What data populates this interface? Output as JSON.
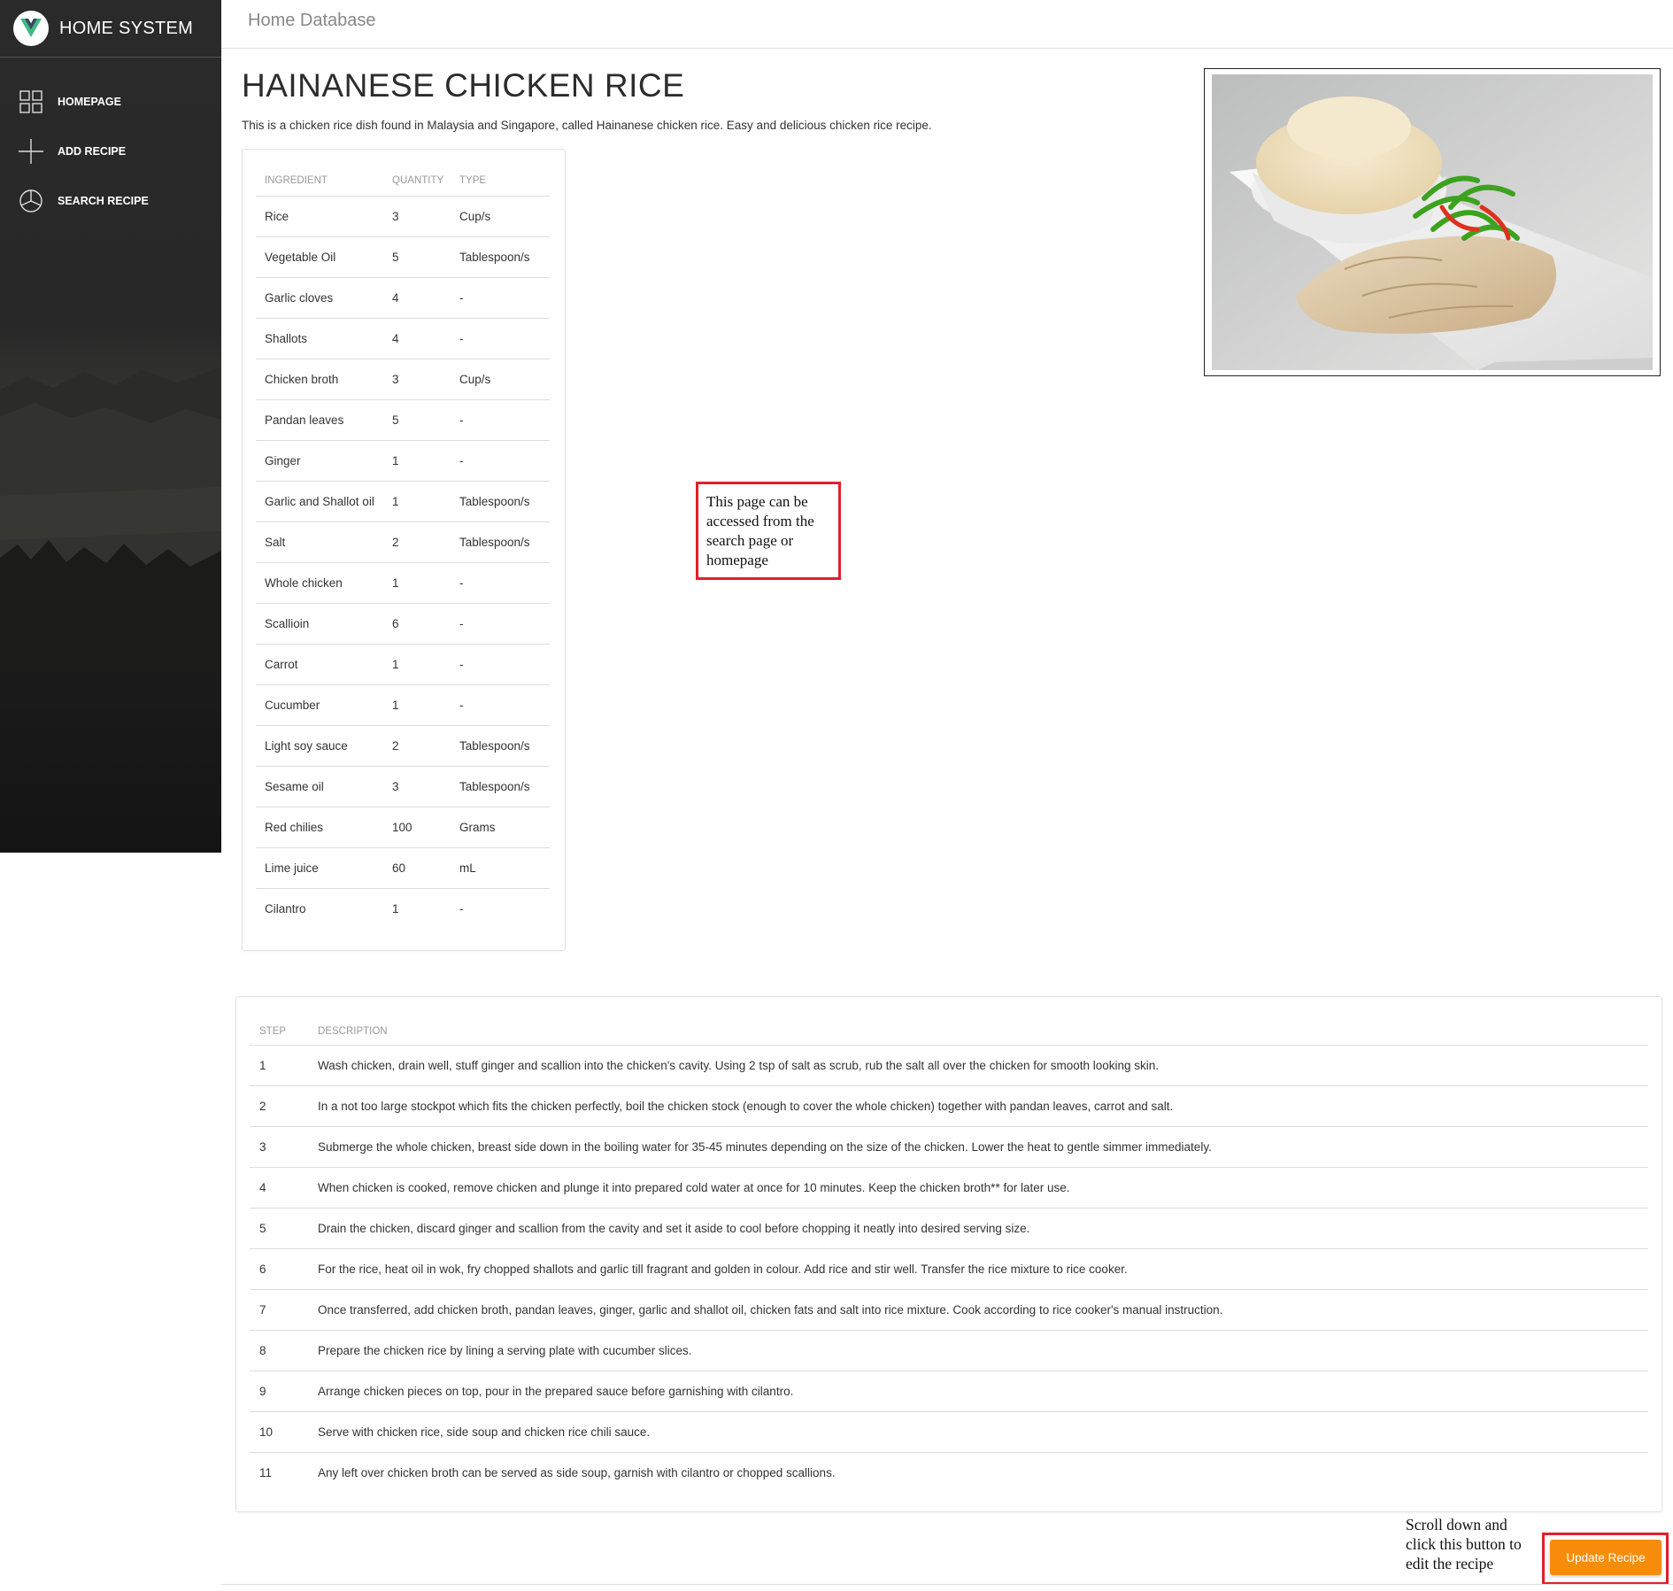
{
  "app": {
    "brand": "HOME SYSTEM",
    "breadcrumb": "Home Database"
  },
  "sidebar": {
    "items": [
      {
        "label": "HOMEPAGE",
        "icon": "grid-icon"
      },
      {
        "label": "ADD RECIPE",
        "icon": "plus-icon"
      },
      {
        "label": "SEARCH RECIPE",
        "icon": "pie-chart-icon"
      }
    ]
  },
  "recipe": {
    "title": "HAINANESE CHICKEN RICE",
    "description": "This is a chicken rice dish found in Malaysia and Singapore, called Hainanese chicken rice. Easy and delicious chicken rice recipe.",
    "image_icon": "chicken-rice-photo"
  },
  "ingredients": {
    "headers": [
      "INGREDIENT",
      "QUANTITY",
      "TYPE"
    ],
    "rows": [
      [
        "Rice",
        "3",
        "Cup/s"
      ],
      [
        "Vegetable Oil",
        "5",
        "Tablespoon/s"
      ],
      [
        "Garlic cloves",
        "4",
        "-"
      ],
      [
        "Shallots",
        "4",
        "-"
      ],
      [
        "Chicken broth",
        "3",
        "Cup/s"
      ],
      [
        "Pandan leaves",
        "5",
        "-"
      ],
      [
        "Ginger",
        "1",
        "-"
      ],
      [
        "Garlic and Shallot oil",
        "1",
        "Tablespoon/s"
      ],
      [
        "Salt",
        "2",
        "Tablespoon/s"
      ],
      [
        "Whole chicken",
        "1",
        "-"
      ],
      [
        "Scallioin",
        "6",
        "-"
      ],
      [
        "Carrot",
        "1",
        "-"
      ],
      [
        "Cucumber",
        "1",
        "-"
      ],
      [
        "Light soy sauce",
        "2",
        "Tablespoon/s"
      ],
      [
        "Sesame oil",
        "3",
        "Tablespoon/s"
      ],
      [
        "Red chilies",
        "100",
        "Grams"
      ],
      [
        "Lime juice",
        "60",
        "mL"
      ],
      [
        "Cilantro",
        "1",
        "-"
      ]
    ]
  },
  "steps": {
    "headers": [
      "STEP",
      "DESCRIPTION"
    ],
    "rows": [
      [
        "1",
        "Wash chicken, drain well, stuff ginger and scallion into the chicken's cavity. Using 2 tsp of salt as scrub, rub the salt all over the chicken for smooth looking skin."
      ],
      [
        "2",
        "In a not too large stockpot which fits the chicken perfectly, boil the chicken stock (enough to cover the whole chicken) together with pandan leaves, carrot and salt."
      ],
      [
        "3",
        "Submerge the whole chicken, breast side down in the boiling water for 35-45 minutes depending on the size of the chicken. Lower the heat to gentle simmer immediately."
      ],
      [
        "4",
        "When chicken is cooked, remove chicken and plunge it into prepared cold water at once for 10 minutes. Keep the chicken broth** for later use."
      ],
      [
        "5",
        "Drain the chicken, discard ginger and scallion from the cavity and set it aside to cool before chopping it neatly into desired serving size."
      ],
      [
        "6",
        "For the rice, heat oil in wok, fry chopped shallots and garlic till fragrant and golden in colour. Add rice and stir well. Transfer the rice mixture to rice cooker."
      ],
      [
        "7",
        "Once transferred, add chicken broth, pandan leaves, ginger, garlic and shallot oil, chicken fats and salt into rice mixture. Cook according to rice cooker's manual instruction."
      ],
      [
        "8",
        "Prepare the chicken rice by lining a serving plate with cucumber slices."
      ],
      [
        "9",
        "Arrange chicken pieces on top, pour in the prepared sauce before garnishing with cilantro."
      ],
      [
        "10",
        "Serve with chicken rice, side soup and chicken rice chili sauce."
      ],
      [
        "11",
        "Any left over chicken broth can be served as side soup, garnish with cilantro or chopped scallions."
      ]
    ]
  },
  "annotations": {
    "callout_1": "This page can be accessed from the search page or homepage",
    "callout_2": "Scroll down and click this button to edit the recipe"
  },
  "actions": {
    "update_label": "Update Recipe"
  },
  "colors": {
    "accent_button": "#f68c0a",
    "callout_border": "#e0202a",
    "sidebar_bg": "#1f1f1f"
  }
}
